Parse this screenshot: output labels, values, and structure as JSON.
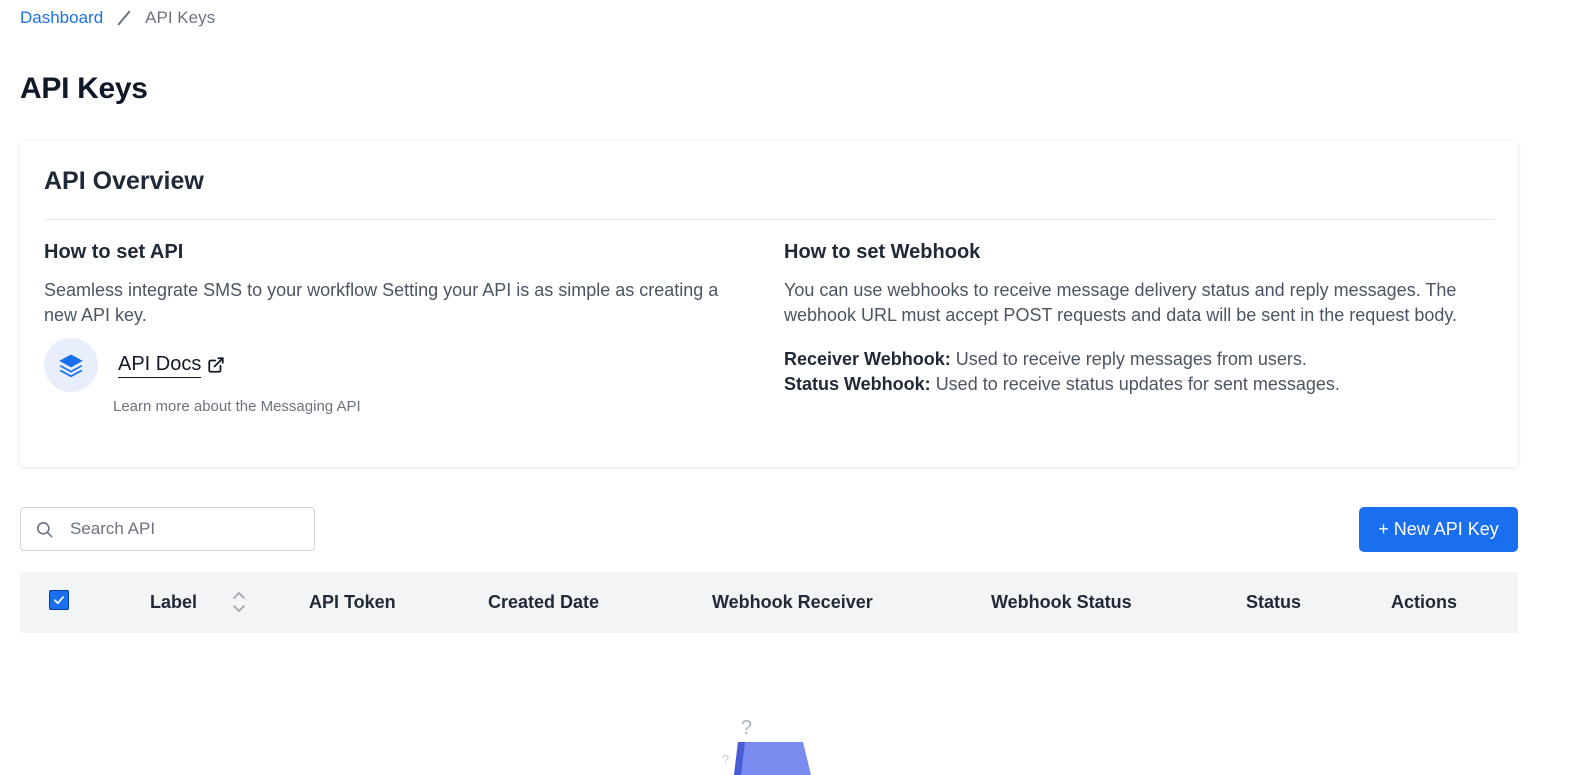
{
  "breadcrumb": {
    "home": "Dashboard",
    "current": "API Keys"
  },
  "page": {
    "title": "API Keys"
  },
  "overview": {
    "title": "API Overview",
    "api": {
      "heading": "How to set API",
      "text": "Seamless integrate SMS to your workflow Setting your API is as simple as creating a new API key.",
      "docs_link": "API Docs",
      "docs_sub": "Learn more about the Messaging API"
    },
    "webhook": {
      "heading": "How to set Webhook",
      "text": "You can use webhooks to receive message delivery status and reply messages. The webhook URL must accept POST requests and data will be sent in the request body.",
      "receiver_label": "Receiver Webhook:",
      "receiver_text": "Used to receive reply messages from users.",
      "status_label": "Status Webhook:",
      "status_text": "Used to receive status updates for sent messages."
    }
  },
  "search": {
    "placeholder": "Search API",
    "value": ""
  },
  "toolbar": {
    "new_key_label": "+ New API Key"
  },
  "table": {
    "columns": [
      "Label",
      "API Token",
      "Created Date",
      "Webhook Receiver",
      "Webhook Status",
      "Status",
      "Actions"
    ],
    "select_all_checked": true
  },
  "empty_state": {
    "mark": "?"
  },
  "colors": {
    "accent": "#1a6ff0",
    "link": "#1a73e8",
    "header_bg": "#f3f4f6",
    "illustration": "#7b8cf0"
  },
  "icons": {
    "docs": "layers-icon",
    "external": "external-link-icon",
    "search": "search-icon",
    "sort": "sort-icon",
    "check": "check-icon"
  }
}
